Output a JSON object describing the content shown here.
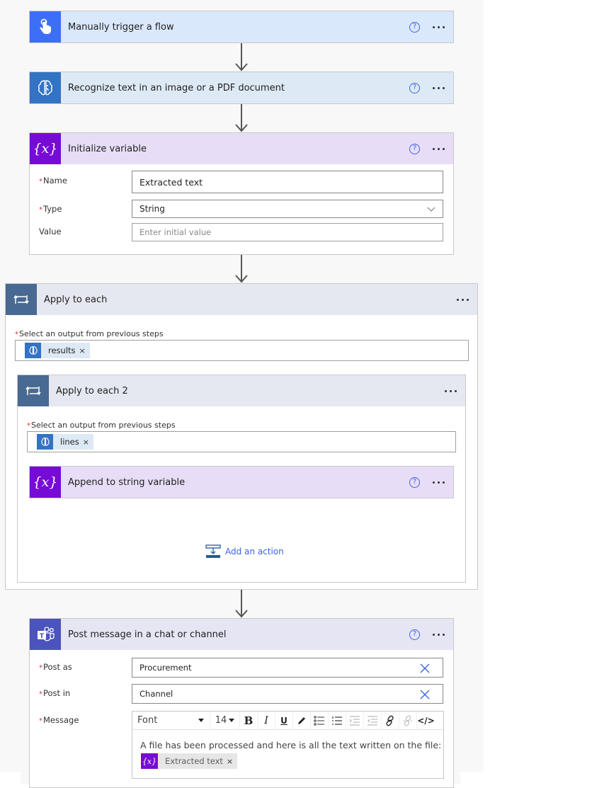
{
  "colors": {
    "trigger_accent": "#3d6ff6",
    "trigger_header": "#dae8fc",
    "ai_accent": "#3373c4",
    "ai_header": "#ddeaf6",
    "variable_accent": "#770bd6",
    "variable_header": "#e8ddf7",
    "loop_accent": "#486991",
    "loop_header": "#e5e8f1",
    "teams_accent": "#4b53bc",
    "teams_header": "#e5e5f4",
    "link_blue": "#3a63e8"
  },
  "steps": {
    "trigger": {
      "title": "Manually trigger a flow",
      "icon": "touch-hand-icon"
    },
    "recognize": {
      "title": "Recognize text in an image or a PDF document",
      "icon": "ai-brain-icon"
    },
    "init_var": {
      "title": "Initialize variable",
      "icon": "variable-icon",
      "fields": {
        "name": {
          "label": "Name",
          "required": "*",
          "value": "Extracted text"
        },
        "type": {
          "label": "Type",
          "required": "*",
          "value": "String"
        },
        "value": {
          "label": "Value",
          "placeholder": "Enter initial value"
        }
      }
    },
    "apply_each": {
      "title": "Apply to each",
      "select_label": "Select an output from previous steps",
      "required": "*",
      "token": {
        "label": "results",
        "remove": "×"
      }
    },
    "apply_each_2": {
      "title": "Apply to each 2",
      "select_label": "Select an output from previous steps",
      "required": "*",
      "token": {
        "label": "lines",
        "remove": "×"
      }
    },
    "append": {
      "title": "Append to string variable"
    },
    "add_action": {
      "label": "Add an action"
    },
    "post_message": {
      "title": "Post message in a chat or channel",
      "fields": {
        "post_as": {
          "label": "Post as",
          "required": "*",
          "value": "Procurement"
        },
        "post_in": {
          "label": "Post in",
          "required": "*",
          "value": "Channel"
        },
        "message": {
          "label": "Message",
          "required": "*",
          "toolbar": {
            "font": "Font",
            "size": "14"
          },
          "text": "A file has been processed and here is all the text written on the file:",
          "token": {
            "label": "Extracted text",
            "remove": "×"
          }
        }
      }
    }
  },
  "common": {
    "help": "?"
  }
}
